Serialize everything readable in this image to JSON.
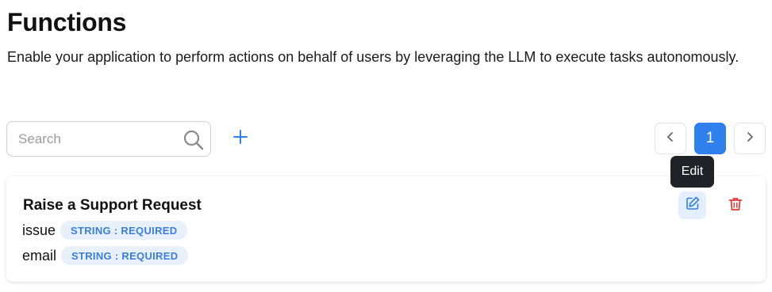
{
  "header": {
    "title": "Functions",
    "description": "Enable your application to perform actions on behalf of users by leveraging the LLM to execute tasks autonomously."
  },
  "toolbar": {
    "search_placeholder": "Search",
    "search_value": "",
    "search_icon": "search-icon",
    "add_icon": "plus-icon"
  },
  "pagination": {
    "prev_icon": "chevron-left-icon",
    "current_page": "1",
    "next_icon": "chevron-right-icon"
  },
  "tooltip": {
    "text": "Edit"
  },
  "functions": [
    {
      "name": "Raise a Support Request",
      "params": [
        {
          "name": "issue",
          "badge": "STRING : REQUIRED"
        },
        {
          "name": "email",
          "badge": "STRING : REQUIRED"
        }
      ],
      "actions": {
        "edit_icon": "edit-icon",
        "delete_icon": "trash-icon"
      }
    }
  ],
  "colors": {
    "accent": "#2f80ed",
    "badge_bg": "#e8f0fc",
    "badge_text": "#3a7fe0",
    "delete": "#e53935",
    "tooltip_bg": "#1f2226"
  }
}
